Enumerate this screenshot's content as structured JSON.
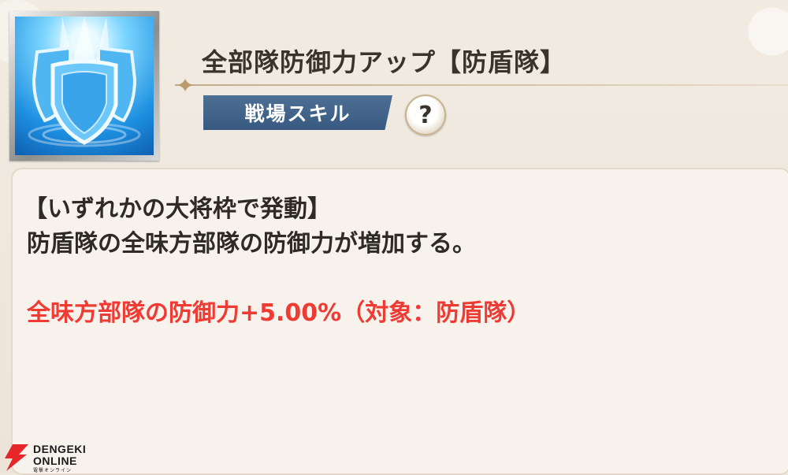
{
  "skill": {
    "title": "全部隊防御力アップ【防盾隊】",
    "category": "戦場スキル",
    "help_symbol": "?",
    "icon": "shield-icon"
  },
  "description": {
    "trigger": "【いずれかの大将枠で発動】",
    "body": "防盾隊の全味方部隊の防御力が増加する。",
    "effect": "全味方部隊の防御力+5.00%（対象：防盾隊）"
  },
  "watermark": {
    "line1": "DENGEKI",
    "line2": "ONLINE",
    "line3": "電撃オンライン"
  },
  "colors": {
    "effect_text": "#ee3b34",
    "badge_bg": "#3d5f86",
    "title_text": "#3a332c"
  }
}
